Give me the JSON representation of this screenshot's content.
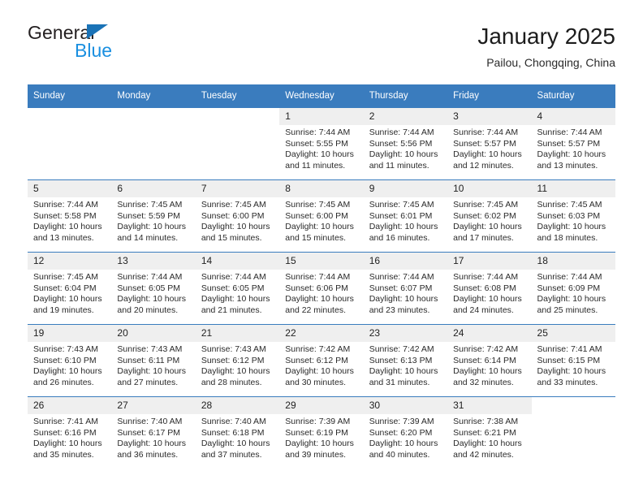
{
  "brand": {
    "name_part1": "General",
    "name_part2": "Blue",
    "logo_icon": "triangle-icon"
  },
  "header": {
    "title": "January 2025",
    "subtitle": "Pailou, Chongqing, China"
  },
  "colors": {
    "header_blue": "#3a7cbe",
    "brand_blue": "#1a8fe0",
    "daynum_bg": "#efefef"
  },
  "calendar": {
    "weekday_headers": [
      "Sunday",
      "Monday",
      "Tuesday",
      "Wednesday",
      "Thursday",
      "Friday",
      "Saturday"
    ],
    "labels": {
      "sunrise": "Sunrise:",
      "sunset": "Sunset:",
      "daylight": "Daylight:"
    },
    "weeks": [
      [
        {
          "day": "",
          "blank": true
        },
        {
          "day": "",
          "blank": true
        },
        {
          "day": "",
          "blank": true
        },
        {
          "day": "1",
          "sunrise": "Sunrise: 7:44 AM",
          "sunset": "Sunset: 5:55 PM",
          "daylight": "Daylight: 10 hours and 11 minutes."
        },
        {
          "day": "2",
          "sunrise": "Sunrise: 7:44 AM",
          "sunset": "Sunset: 5:56 PM",
          "daylight": "Daylight: 10 hours and 11 minutes."
        },
        {
          "day": "3",
          "sunrise": "Sunrise: 7:44 AM",
          "sunset": "Sunset: 5:57 PM",
          "daylight": "Daylight: 10 hours and 12 minutes."
        },
        {
          "day": "4",
          "sunrise": "Sunrise: 7:44 AM",
          "sunset": "Sunset: 5:57 PM",
          "daylight": "Daylight: 10 hours and 13 minutes."
        }
      ],
      [
        {
          "day": "5",
          "sunrise": "Sunrise: 7:44 AM",
          "sunset": "Sunset: 5:58 PM",
          "daylight": "Daylight: 10 hours and 13 minutes."
        },
        {
          "day": "6",
          "sunrise": "Sunrise: 7:45 AM",
          "sunset": "Sunset: 5:59 PM",
          "daylight": "Daylight: 10 hours and 14 minutes."
        },
        {
          "day": "7",
          "sunrise": "Sunrise: 7:45 AM",
          "sunset": "Sunset: 6:00 PM",
          "daylight": "Daylight: 10 hours and 15 minutes."
        },
        {
          "day": "8",
          "sunrise": "Sunrise: 7:45 AM",
          "sunset": "Sunset: 6:00 PM",
          "daylight": "Daylight: 10 hours and 15 minutes."
        },
        {
          "day": "9",
          "sunrise": "Sunrise: 7:45 AM",
          "sunset": "Sunset: 6:01 PM",
          "daylight": "Daylight: 10 hours and 16 minutes."
        },
        {
          "day": "10",
          "sunrise": "Sunrise: 7:45 AM",
          "sunset": "Sunset: 6:02 PM",
          "daylight": "Daylight: 10 hours and 17 minutes."
        },
        {
          "day": "11",
          "sunrise": "Sunrise: 7:45 AM",
          "sunset": "Sunset: 6:03 PM",
          "daylight": "Daylight: 10 hours and 18 minutes."
        }
      ],
      [
        {
          "day": "12",
          "sunrise": "Sunrise: 7:45 AM",
          "sunset": "Sunset: 6:04 PM",
          "daylight": "Daylight: 10 hours and 19 minutes."
        },
        {
          "day": "13",
          "sunrise": "Sunrise: 7:44 AM",
          "sunset": "Sunset: 6:05 PM",
          "daylight": "Daylight: 10 hours and 20 minutes."
        },
        {
          "day": "14",
          "sunrise": "Sunrise: 7:44 AM",
          "sunset": "Sunset: 6:05 PM",
          "daylight": "Daylight: 10 hours and 21 minutes."
        },
        {
          "day": "15",
          "sunrise": "Sunrise: 7:44 AM",
          "sunset": "Sunset: 6:06 PM",
          "daylight": "Daylight: 10 hours and 22 minutes."
        },
        {
          "day": "16",
          "sunrise": "Sunrise: 7:44 AM",
          "sunset": "Sunset: 6:07 PM",
          "daylight": "Daylight: 10 hours and 23 minutes."
        },
        {
          "day": "17",
          "sunrise": "Sunrise: 7:44 AM",
          "sunset": "Sunset: 6:08 PM",
          "daylight": "Daylight: 10 hours and 24 minutes."
        },
        {
          "day": "18",
          "sunrise": "Sunrise: 7:44 AM",
          "sunset": "Sunset: 6:09 PM",
          "daylight": "Daylight: 10 hours and 25 minutes."
        }
      ],
      [
        {
          "day": "19",
          "sunrise": "Sunrise: 7:43 AM",
          "sunset": "Sunset: 6:10 PM",
          "daylight": "Daylight: 10 hours and 26 minutes."
        },
        {
          "day": "20",
          "sunrise": "Sunrise: 7:43 AM",
          "sunset": "Sunset: 6:11 PM",
          "daylight": "Daylight: 10 hours and 27 minutes."
        },
        {
          "day": "21",
          "sunrise": "Sunrise: 7:43 AM",
          "sunset": "Sunset: 6:12 PM",
          "daylight": "Daylight: 10 hours and 28 minutes."
        },
        {
          "day": "22",
          "sunrise": "Sunrise: 7:42 AM",
          "sunset": "Sunset: 6:12 PM",
          "daylight": "Daylight: 10 hours and 30 minutes."
        },
        {
          "day": "23",
          "sunrise": "Sunrise: 7:42 AM",
          "sunset": "Sunset: 6:13 PM",
          "daylight": "Daylight: 10 hours and 31 minutes."
        },
        {
          "day": "24",
          "sunrise": "Sunrise: 7:42 AM",
          "sunset": "Sunset: 6:14 PM",
          "daylight": "Daylight: 10 hours and 32 minutes."
        },
        {
          "day": "25",
          "sunrise": "Sunrise: 7:41 AM",
          "sunset": "Sunset: 6:15 PM",
          "daylight": "Daylight: 10 hours and 33 minutes."
        }
      ],
      [
        {
          "day": "26",
          "sunrise": "Sunrise: 7:41 AM",
          "sunset": "Sunset: 6:16 PM",
          "daylight": "Daylight: 10 hours and 35 minutes."
        },
        {
          "day": "27",
          "sunrise": "Sunrise: 7:40 AM",
          "sunset": "Sunset: 6:17 PM",
          "daylight": "Daylight: 10 hours and 36 minutes."
        },
        {
          "day": "28",
          "sunrise": "Sunrise: 7:40 AM",
          "sunset": "Sunset: 6:18 PM",
          "daylight": "Daylight: 10 hours and 37 minutes."
        },
        {
          "day": "29",
          "sunrise": "Sunrise: 7:39 AM",
          "sunset": "Sunset: 6:19 PM",
          "daylight": "Daylight: 10 hours and 39 minutes."
        },
        {
          "day": "30",
          "sunrise": "Sunrise: 7:39 AM",
          "sunset": "Sunset: 6:20 PM",
          "daylight": "Daylight: 10 hours and 40 minutes."
        },
        {
          "day": "31",
          "sunrise": "Sunrise: 7:38 AM",
          "sunset": "Sunset: 6:21 PM",
          "daylight": "Daylight: 10 hours and 42 minutes."
        },
        {
          "day": "",
          "blank": true
        }
      ]
    ]
  }
}
